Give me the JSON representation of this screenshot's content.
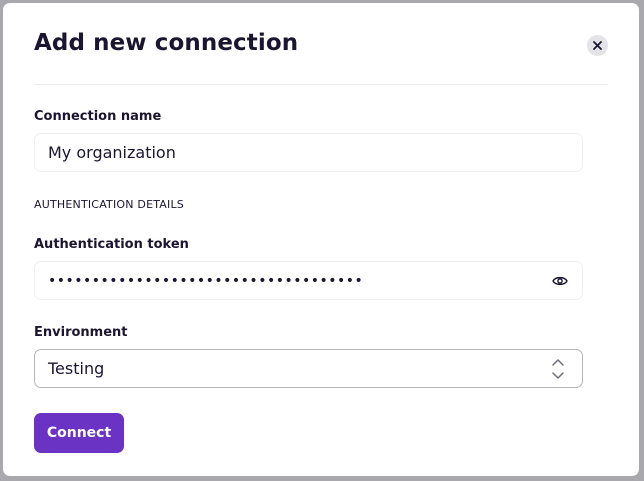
{
  "dialog": {
    "title": "Add new connection",
    "close_icon": "close-icon"
  },
  "form": {
    "connection_name": {
      "label": "Connection name",
      "value": "My organization"
    },
    "auth_section_label": "AUTHENTICATION DETAILS",
    "auth_token": {
      "label": "Authentication token",
      "masked_value": "••••••••••••••••••••••••••••••••••••",
      "toggle_icon": "eye-icon"
    },
    "environment": {
      "label": "Environment",
      "selected": "Testing",
      "icon": "chevron-up-down-icon"
    },
    "submit_label": "Connect"
  },
  "colors": {
    "primary": "#6b33c4",
    "text": "#1c1530",
    "backdrop": "#a9a9ad"
  }
}
